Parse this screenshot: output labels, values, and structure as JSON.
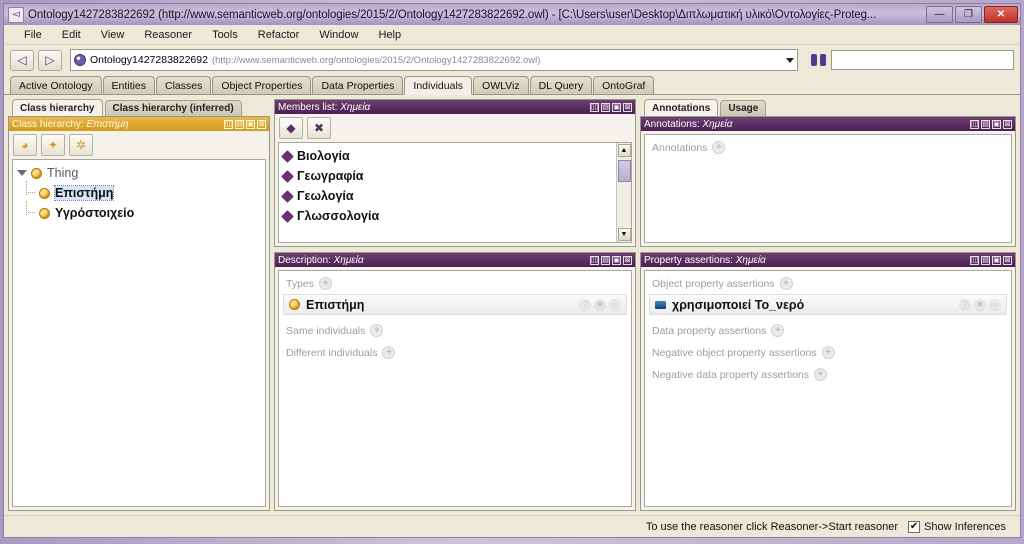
{
  "window": {
    "title": "Ontology1427283822692 (http://www.semanticweb.org/ontologies/2015/2/Ontology1427283822692.owl) - [C:\\Users\\user\\Desktop\\Διπλωματική υλικό\\Οντολογίες-Proteg...",
    "app_icon": "protege-icon",
    "minimize_label": "—",
    "maximize_label": "❐",
    "close_label": "✕"
  },
  "menubar": {
    "items": [
      "File",
      "Edit",
      "View",
      "Reasoner",
      "Tools",
      "Refactor",
      "Window",
      "Help"
    ]
  },
  "toolbar": {
    "back_label": "◁",
    "forward_label": "▷",
    "ontology_name": "Ontology1427283822692",
    "ontology_uri": "(http://www.semanticweb.org/ontologies/2015/2/Ontology1427283822692.owl)",
    "search_placeholder": "",
    "search_value": "",
    "search_icon": "binoculars-icon"
  },
  "tabs": [
    {
      "label": "Active Ontology",
      "active": false
    },
    {
      "label": "Entities",
      "active": false
    },
    {
      "label": "Classes",
      "active": false
    },
    {
      "label": "Object Properties",
      "active": false
    },
    {
      "label": "Data Properties",
      "active": false
    },
    {
      "label": "Individuals",
      "active": true
    },
    {
      "label": "OWLViz",
      "active": false
    },
    {
      "label": "DL Query",
      "active": false
    },
    {
      "label": "OntoGraf",
      "active": false
    }
  ],
  "class_hierarchy": {
    "subtabs": [
      {
        "label": "Class hierarchy",
        "active": true
      },
      {
        "label": "Class hierarchy (inferred)",
        "active": false
      }
    ],
    "header_prefix": "Class hierarchy:",
    "header_value": "Επιστήμη",
    "toolbar_buttons": [
      {
        "name": "add-subclass-button",
        "glyph": "◕"
      },
      {
        "name": "add-sibling-class-button",
        "glyph": "✦"
      },
      {
        "name": "delete-class-button",
        "glyph": "✲"
      }
    ],
    "tree": [
      {
        "label": "Thing",
        "level": 0,
        "selected": false,
        "bold": false,
        "expanded": true
      },
      {
        "label": "Επιστήμη",
        "level": 1,
        "selected": true,
        "bold": true
      },
      {
        "label": "Υγρόστοιχείο",
        "level": 1,
        "selected": false,
        "bold": true
      }
    ]
  },
  "members_list": {
    "header_prefix": "Members list:",
    "header_value": "Χημεία",
    "toolbar_buttons": [
      {
        "name": "add-individual-button",
        "glyph": "◆"
      },
      {
        "name": "delete-individual-button",
        "glyph": "✖"
      }
    ],
    "items": [
      "Βιολογία",
      "Γεωγραφία",
      "Γεωλογία",
      "Γλωσσολογία"
    ],
    "scroll_up": "▲",
    "scroll_down": "▼"
  },
  "annotations": {
    "subtabs": [
      {
        "label": "Annotations",
        "active": true
      },
      {
        "label": "Usage",
        "active": false
      }
    ],
    "header_prefix": "Annotations:",
    "header_value": "Χημεία",
    "section_label": "Annotations"
  },
  "description": {
    "header_prefix": "Description:",
    "header_value": "Χημεία",
    "sections": [
      {
        "label": "Types",
        "rows": [
          {
            "text": "Επιστήμη",
            "icon": "class-dot-icon"
          }
        ]
      },
      {
        "label": "Same individuals",
        "rows": []
      },
      {
        "label": "Different individuals",
        "rows": []
      }
    ]
  },
  "property_assertions": {
    "header_prefix": "Property assertions:",
    "header_value": "Χημεία",
    "sections": [
      {
        "label": "Object property assertions",
        "rows": [
          {
            "text": "χρησιμοποιεί Το_νερό",
            "icon": "object-property-icon"
          }
        ]
      },
      {
        "label": "Data property assertions",
        "rows": []
      },
      {
        "label": "Negative object property assertions",
        "rows": []
      },
      {
        "label": "Negative data property assertions",
        "rows": []
      }
    ]
  },
  "panel_controls": [
    "▯▯",
    "▤",
    "▣",
    "⊠"
  ],
  "row_icons": [
    "?",
    "✖",
    "○"
  ],
  "statusbar": {
    "hint": "To use the reasoner click Reasoner->Start reasoner",
    "checkbox_label": "Show Inferences",
    "checkbox_checked": true,
    "check_glyph": "✔"
  },
  "colors": {
    "panel_header_purple": "#4a1f53",
    "panel_header_gold": "#d39a1c",
    "individual_diamond": "#6b2f72",
    "class_dot": "#e0a51d",
    "selection": "#d6e3f5",
    "close_button": "#c03226"
  }
}
